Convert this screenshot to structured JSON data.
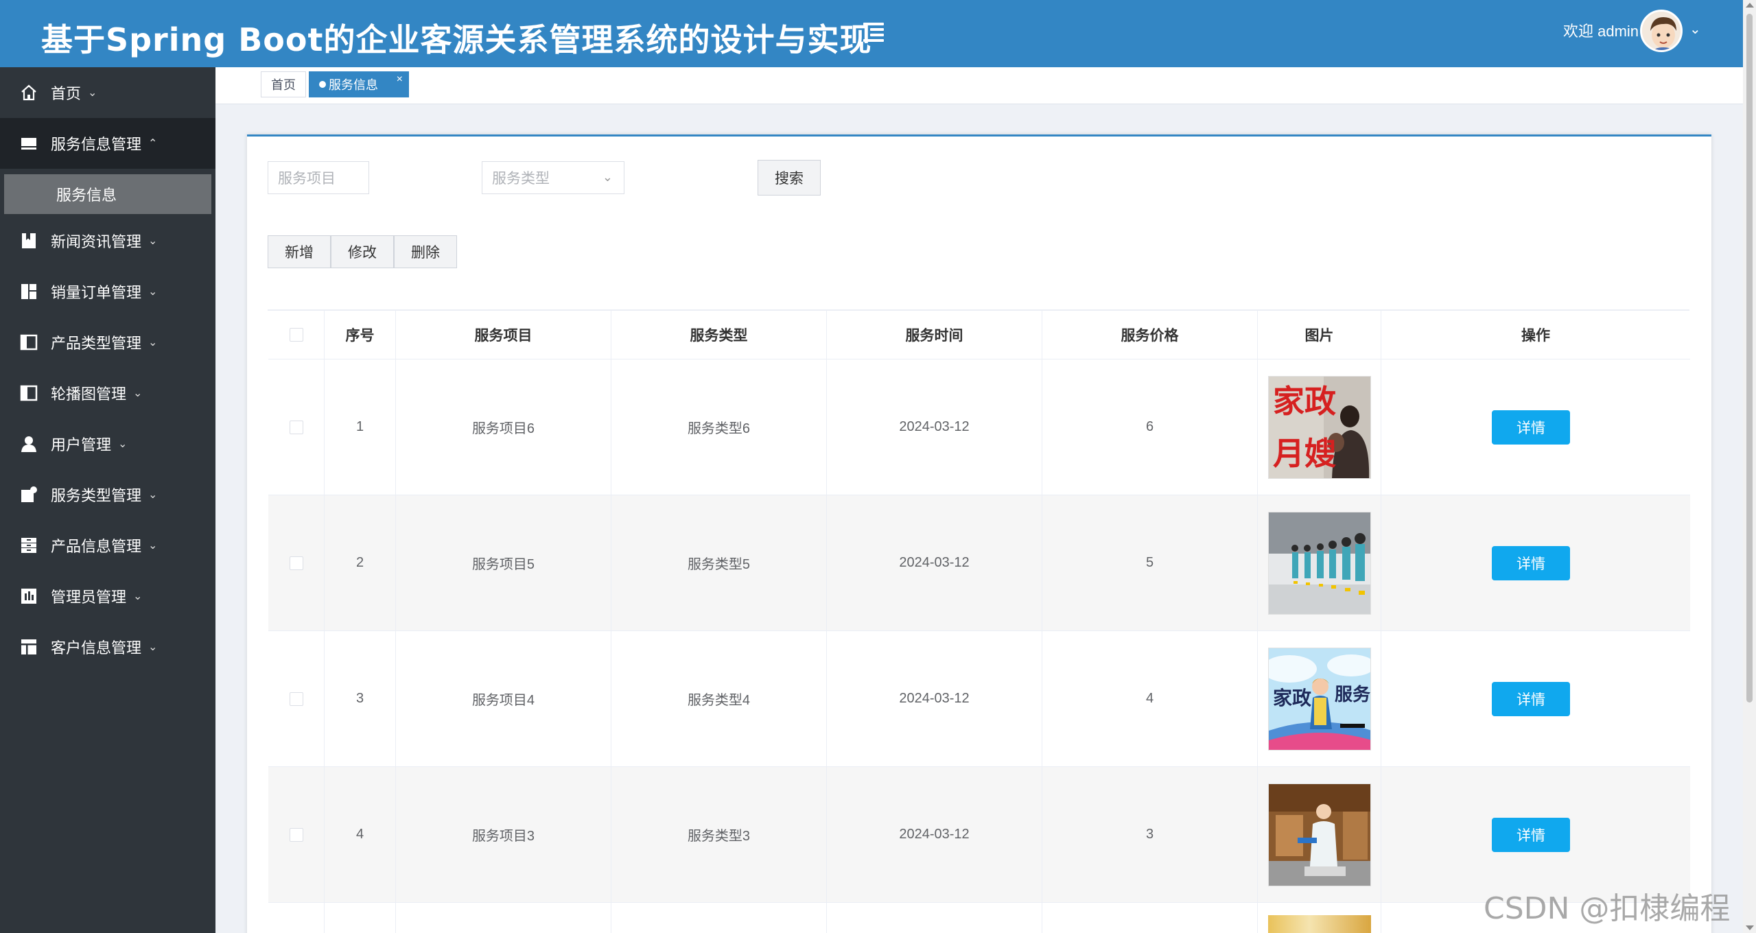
{
  "header": {
    "title": "基于Spring Boot的企业客源关系管理系统的设计与实现",
    "welcome": "欢迎 admin",
    "accent_color": "#3386c4"
  },
  "sidebar": {
    "items": [
      {
        "label": "首页",
        "icon": "home-icon",
        "chevron": "⌄"
      },
      {
        "label": "服务信息管理",
        "icon": "service-info-icon",
        "chevron": "⌃"
      },
      {
        "label": "新闻资讯管理",
        "icon": "bookmark-icon",
        "chevron": "⌄"
      },
      {
        "label": "销量订单管理",
        "icon": "dashboard-icon",
        "chevron": "⌄"
      },
      {
        "label": "产品类型管理",
        "icon": "columns-icon",
        "chevron": "⌄"
      },
      {
        "label": "轮播图管理",
        "icon": "carousel-icon",
        "chevron": "⌄"
      },
      {
        "label": "用户管理",
        "icon": "user-icon",
        "chevron": "⌄"
      },
      {
        "label": "服务类型管理",
        "icon": "doc-add-icon",
        "chevron": "⌄"
      },
      {
        "label": "产品信息管理",
        "icon": "archive-icon",
        "chevron": "⌄"
      },
      {
        "label": "管理员管理",
        "icon": "chart-icon",
        "chevron": "⌄"
      },
      {
        "label": "客户信息管理",
        "icon": "table-icon",
        "chevron": "⌄"
      }
    ],
    "sub_item": "服务信息"
  },
  "tabs": [
    {
      "label": "首页"
    },
    {
      "label": "服务信息",
      "close": "×"
    }
  ],
  "search": {
    "project_placeholder": "服务项目",
    "type_placeholder": "服务类型",
    "search_label": "搜索"
  },
  "actions": {
    "add": "新增",
    "edit": "修改",
    "delete": "删除"
  },
  "table": {
    "columns": [
      "序号",
      "服务项目",
      "服务类型",
      "服务时间",
      "服务价格",
      "图片",
      "操作"
    ],
    "rows": [
      {
        "index": "1",
        "project": "服务项目6",
        "type": "服务类型6",
        "time": "2024-03-12",
        "price": "6",
        "action": "详情"
      },
      {
        "index": "2",
        "project": "服务项目5",
        "type": "服务类型5",
        "time": "2024-03-12",
        "price": "5",
        "action": "详情"
      },
      {
        "index": "3",
        "project": "服务项目4",
        "type": "服务类型4",
        "time": "2024-03-12",
        "price": "4",
        "action": "详情"
      },
      {
        "index": "4",
        "project": "服务项目3",
        "type": "服务类型3",
        "time": "2024-03-12",
        "price": "3",
        "action": "详情"
      }
    ],
    "thumb_texts": {
      "t1a": "家政",
      "t1b": "月嫂",
      "t3a": "家政",
      "t3b": "服务"
    }
  },
  "watermark": "CSDN @扣棣编程"
}
